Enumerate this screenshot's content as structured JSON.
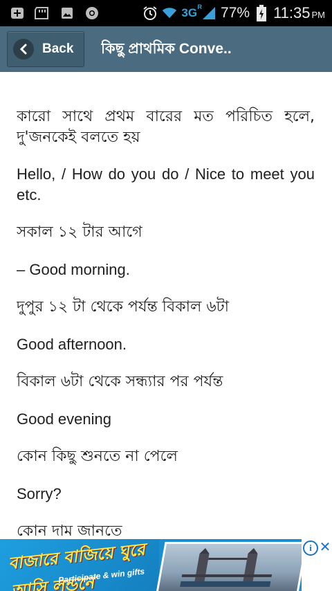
{
  "status_bar": {
    "battery_percent": "77%",
    "network": "3G",
    "network_sup": "R",
    "time": "11:35",
    "ampm": "PM"
  },
  "app_bar": {
    "back_label": "Back",
    "title": "কিছু প্রাথমিক Conve.."
  },
  "content": {
    "paragraphs": [
      "কারো সাথে প্রথম বারের মত পরিচিত হলে, দু'জনকেই বলতে হয়",
      "Hello, / How do you do / Nice to meet you etc.",
      "সকাল ১২ টার আগে",
      "– Good morning.",
      "দুপুর ১২ টা থেকে পর্যন্ত বিকাল ৬টা",
      "Good afternoon.",
      "বিকাল ৬টা থেকে সন্ধ্যার পর পর্যন্ত",
      "Good evening",
      "কোন কিছু শুনতে না পেলে",
      "Sorry?",
      "কোন দাম জানতে"
    ]
  },
  "ad": {
    "headline": "বাজারে বাজিয়ে ঘুরে আসি লন্ডনে",
    "subtext": "Participate & win gifts",
    "colors": {
      "background": "#1a8fcf",
      "headline": "#ffe640"
    }
  },
  "colors": {
    "app_bar": "#4b6b80",
    "status_bar": "#000000",
    "text": "#202020"
  }
}
